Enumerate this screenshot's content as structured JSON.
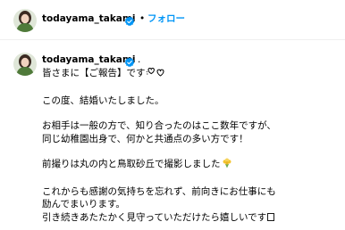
{
  "header": {
    "username": "todayama_takami",
    "separator": "•",
    "follow_label": "フォロー"
  },
  "post": {
    "username": "todayama_takami",
    "separator": "."
  },
  "caption": {
    "line1": "皆さまに【ご報告】です",
    "line2": "この度、結婚いたしました。",
    "line3": "お相手は一般の方で、知り合ったのはここ数年ですが、",
    "line4": "同じ幼稚園出身で、何かと共通点の多い方です！",
    "line5": "前撮りは丸の内と鳥取砂丘で撮影しました",
    "line6": "これからも感謝の気持ちを忘れず、前向きにお仕事にも",
    "line7": "励んでまいります。",
    "line8": "引き続きあたたかく見守っていただけたら嬉しいです",
    "line9": "."
  },
  "colors": {
    "accent": "#0095f6",
    "verified": "#0095f6",
    "divider": "#efefef"
  },
  "icons": {
    "verified": "verified-badge-icon",
    "hearts": "hearts-icon",
    "bouquet": "bouquet-icon",
    "sparkle": "sparkle-icon"
  }
}
